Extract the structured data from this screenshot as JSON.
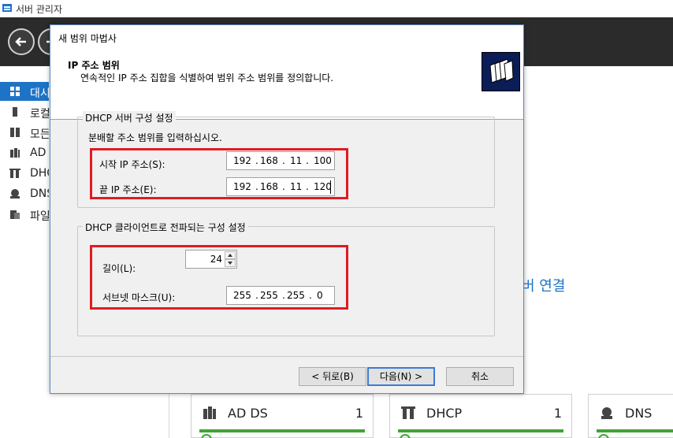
{
  "app": {
    "title": "서버 관리자"
  },
  "sidebar": {
    "items": [
      {
        "label": "대시",
        "icon": "dashboard-icon"
      },
      {
        "label": "로컬",
        "icon": "local-server-icon"
      },
      {
        "label": "모든",
        "icon": "all-servers-icon"
      },
      {
        "label": "AD",
        "icon": "ad-icon"
      },
      {
        "label": "DHC",
        "icon": "dhcp-icon"
      },
      {
        "label": "DNS",
        "icon": "dns-icon"
      },
      {
        "label": "파일",
        "icon": "file-services-icon"
      }
    ]
  },
  "main": {
    "connect_link": "버 연결",
    "tiles": [
      {
        "name": "AD DS",
        "count": "1",
        "icon": "ad-ds-icon"
      },
      {
        "name": "DHCP",
        "count": "1",
        "icon": "dhcp-icon"
      },
      {
        "name": "DNS",
        "count": "",
        "icon": "dns-icon"
      }
    ]
  },
  "wizard": {
    "title": "새 범위 마법사",
    "header_title": "IP 주소 범위",
    "header_subtitle": "연속적인 IP 주소 집합을 식별하여 범위 주소 범위를 정의합니다.",
    "group1": {
      "label": "DHCP 서버 구성 설정",
      "instruction": "분배할 주소 범위를 입력하십시오.",
      "start_label": "시작 IP 주소(S):",
      "start_ip": [
        "192",
        "168",
        "11",
        "100"
      ],
      "end_label": "끝 IP 주소(E):",
      "end_ip": [
        "192",
        "168",
        "11",
        "120"
      ]
    },
    "group2": {
      "label": "DHCP 클라이언트로 전파되는 구성 설정",
      "length_label": "길이(L):",
      "length_value": "24",
      "mask_label": "서브넷 마스크(U):",
      "mask": [
        "255",
        "255",
        "255",
        "0"
      ]
    },
    "buttons": {
      "back": "< 뒤로(B)",
      "next": "다음(N) >",
      "cancel": "취소"
    }
  },
  "colors": {
    "accent": "#1e73c6",
    "header_dark": "#2b2b2b",
    "highlight_red": "#e11b22",
    "status_green": "#3fa535"
  }
}
